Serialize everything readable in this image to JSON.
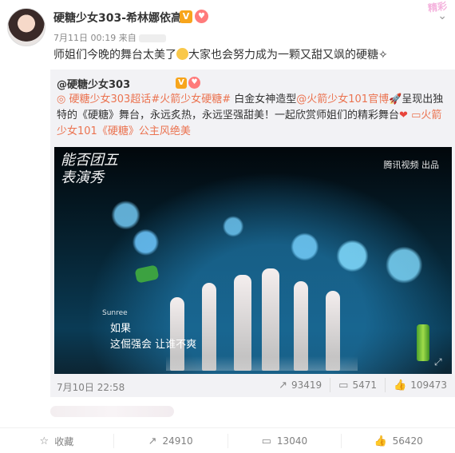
{
  "post": {
    "username": "硬糖少女303-希林娜依高",
    "verified_badge": "V",
    "fan_badge": "♥",
    "meta_time": "7月11日 00:19 来自",
    "deco_text": "精彩",
    "text_before_emoji": "师姐们今晚的舞台太美了",
    "text_after_emoji": "大家也会努力成为一颗又甜又飒的硬糖",
    "text_end_icon": "✧"
  },
  "repost": {
    "username": "@硬糖少女303",
    "verified_badge": "V",
    "fan_badge": "♥",
    "text": {
      "link1": "硬糖少女303超话",
      "topic1": "#火箭少女硬糖#",
      "plain1": " 白金女神造型",
      "mention1": "@火箭少女101官博",
      "plain2": "呈现出独特的《硬糖》舞台，永远炙热，永远坚强甜美！一起欣赏师姐们的精彩舞台",
      "heart": "❤",
      "link2": "火箭少女101《硬糖》公主风绝美"
    },
    "video": {
      "overlay_title": "能否团五\n表演秀",
      "watermark": "腾讯视频 出品",
      "brand_small": "Sunree",
      "subtitle_line1": "如果",
      "subtitle_line2": "这倔强会 让谁不爽"
    },
    "date": "7月10日 22:58",
    "stats": {
      "reposts": "93419",
      "comments": "5471",
      "likes": "109473"
    }
  },
  "actions": {
    "collect": "收藏",
    "repost": "24910",
    "comment": "13040",
    "like": "56420"
  },
  "icons": {
    "collect": "star-icon",
    "repost": "share-icon",
    "comment": "comment-icon",
    "like": "thumbs-up-icon"
  },
  "colors": {
    "link": "#eb7350",
    "badge": "#f7a51c",
    "muted": "#808080"
  }
}
